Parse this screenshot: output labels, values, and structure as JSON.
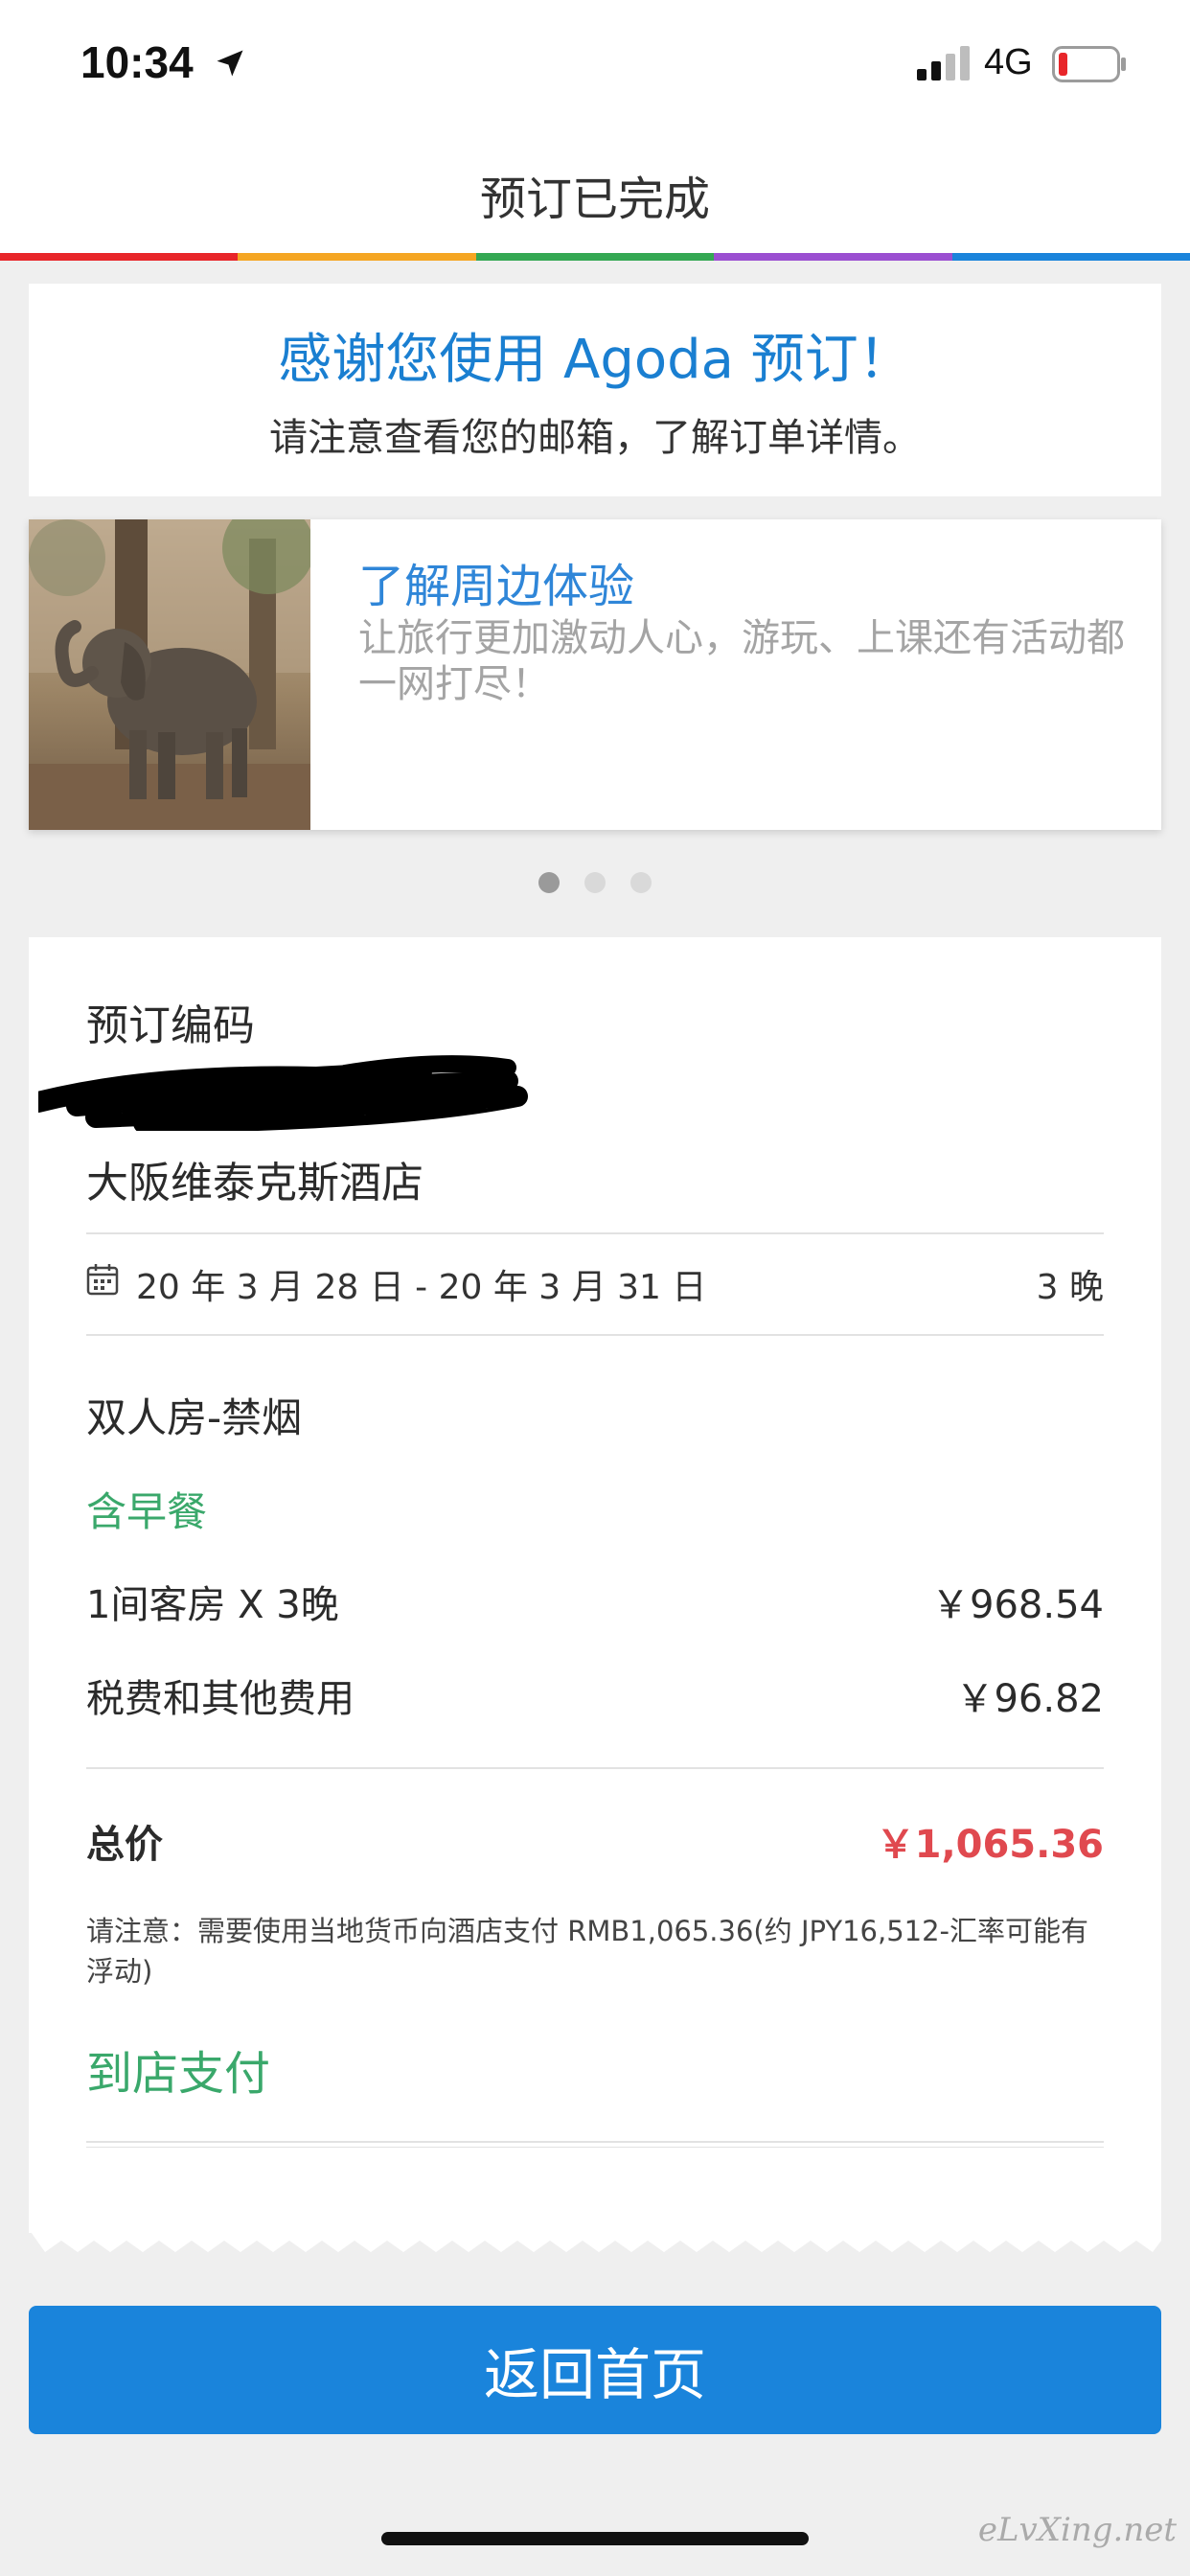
{
  "status_bar": {
    "time": "10:34",
    "network": "4G",
    "icons": [
      "location-arrow-icon",
      "signal-icon",
      "battery-icon"
    ]
  },
  "header": {
    "title": "预订已完成",
    "stripe_colors": [
      "#e8262a",
      "#f5a623",
      "#34a853",
      "#9b4fd1",
      "#1a84db"
    ]
  },
  "thanks": {
    "title": "感谢您使用 Agoda 预订！",
    "subtitle": "请注意查看您的邮箱，了解订单详情。"
  },
  "promo": {
    "image_icon": "elephant-photo",
    "title": "了解周边体验",
    "description": "让旅行更加激动人心，游玩、上课还有活动都一网打尽！",
    "dots_total": 3,
    "active_dot": 1
  },
  "booking": {
    "code_label": "预订编码",
    "hotel_name": "大阪维泰克斯酒店",
    "dates": "20 年 3 月 28 日 - 20 年 3 月 31 日",
    "nights": "3 晚",
    "room_type": "双人房-禁烟",
    "breakfast": "含早餐",
    "rooms_label": "1间客房 X 3晚",
    "rooms_price": "￥968.54",
    "tax_label": "税费和其他费用",
    "tax_price": "￥96.82",
    "total_label": "总价",
    "total_price": "￥1,065.36",
    "note": "请注意：需要使用当地货币向酒店支付 RMB1,065.36(约 JPY16,512-汇率可能有浮动)",
    "payment_method": "到店支付"
  },
  "actions": {
    "home_button": "返回首页"
  },
  "watermark": "eLvXing.net",
  "colors": {
    "brand_blue": "#1a84db",
    "price_red": "#e0494f",
    "success_green": "#3aa86b"
  }
}
